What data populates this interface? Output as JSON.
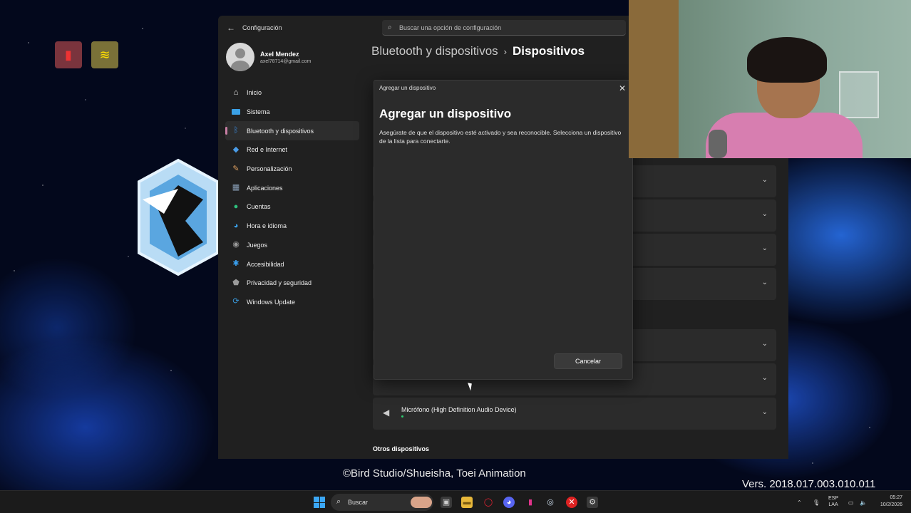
{
  "settings": {
    "app_title": "Configuración",
    "search_placeholder": "Buscar una opción de configuración",
    "user": {
      "name": "Axel Mendez",
      "email": "axel78714@gmail.com"
    },
    "nav": [
      {
        "label": "Inicio",
        "icon": "home-icon",
        "color": "#f4f4f4"
      },
      {
        "label": "Sistema",
        "icon": "system-icon",
        "color": "#3aa0e6"
      },
      {
        "label": "Bluetooth y dispositivos",
        "icon": "bluetooth-icon",
        "color": "#3a8ee6",
        "active": true
      },
      {
        "label": "Red e Internet",
        "icon": "network-icon",
        "color": "#4a9ce8"
      },
      {
        "label": "Personalización",
        "icon": "brush-icon",
        "color": "#e0a060"
      },
      {
        "label": "Aplicaciones",
        "icon": "apps-icon",
        "color": "#8aa0b8"
      },
      {
        "label": "Cuentas",
        "icon": "accounts-icon",
        "color": "#2ec27e"
      },
      {
        "label": "Hora e idioma",
        "icon": "time-language-icon",
        "color": "#3a9ee6"
      },
      {
        "label": "Juegos",
        "icon": "gamepad-icon",
        "color": "#9a9a9a"
      },
      {
        "label": "Accesibilidad",
        "icon": "accessibility-icon",
        "color": "#3aa0f0"
      },
      {
        "label": "Privacidad y seguridad",
        "icon": "shield-icon",
        "color": "#9a9a9a"
      },
      {
        "label": "Windows Update",
        "icon": "update-icon",
        "color": "#3aa0e6"
      }
    ],
    "breadcrumb": {
      "parent": "Bluetooth y dispositivos",
      "separator": "›",
      "current": "Dispositivos"
    },
    "devices": {
      "microphone": "Micrófono (High Definition Audio Device)",
      "other_section": "Otros dispositivos"
    }
  },
  "dialog": {
    "titlebar": "Agregar un dispositivo",
    "heading": "Agregar un dispositivo",
    "description": "Asegúrate de que el dispositivo esté activado y sea reconocible. Selecciona un dispositivo de la lista para conectarte.",
    "cancel_label": "Cancelar"
  },
  "overlay": {
    "copyright": "©Bird Studio/Shueisha, Toei Animation",
    "version": "Vers. 2018.017.003.010.011"
  },
  "taskbar": {
    "search_label": "Buscar",
    "language": {
      "line1": "ESP",
      "line2": "LAA"
    },
    "time": "05:27",
    "date": "10/2/2026"
  },
  "colors": {
    "accent": "#c87ea4",
    "window_bg": "#202020",
    "card_bg": "#2b2b2b"
  }
}
